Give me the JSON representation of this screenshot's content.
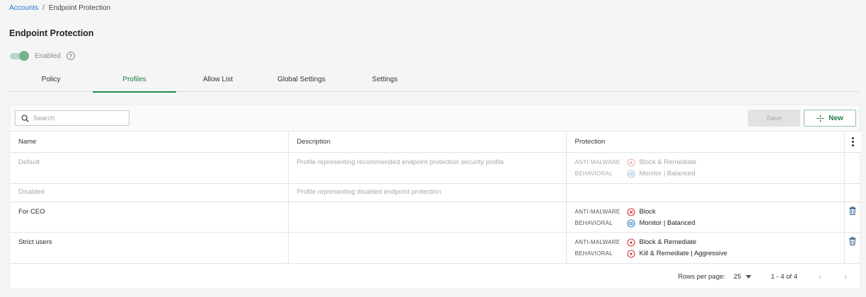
{
  "breadcrumb": {
    "root": "Accounts",
    "separator": "/",
    "current": "Endpoint Protection"
  },
  "page": {
    "title": "Endpoint Protection"
  },
  "status_toggle": {
    "label": "Enabled",
    "enabled": true,
    "help": "?"
  },
  "tabs": [
    {
      "label": "Policy",
      "active": false
    },
    {
      "label": "Profiles",
      "active": true
    },
    {
      "label": "Allow List",
      "active": false
    },
    {
      "label": "Global Settings",
      "active": false
    },
    {
      "label": "Settings",
      "active": false
    }
  ],
  "toolbar": {
    "search_placeholder": "Search",
    "save_label": "Save",
    "new_label": "New"
  },
  "table": {
    "columns": [
      "Name",
      "Description",
      "Protection"
    ],
    "rows": [
      {
        "name": "Default",
        "description": "Profile representing recommended endpoint protection security profile",
        "disabled": true,
        "protection": [
          {
            "label": "ANTI-MALWARE",
            "icon": "target-remediate-icon",
            "value": "Block & Remediate"
          },
          {
            "label": "BEHAVIORAL",
            "icon": "eye-monitor-icon",
            "value": "Monitor | Balanced"
          }
        ]
      },
      {
        "name": "Disabled",
        "description": "Profile representing disabled endpoint protection",
        "disabled": true,
        "protection": []
      },
      {
        "name": "For CEO",
        "description": "",
        "disabled": false,
        "protection": [
          {
            "label": "ANTI-MALWARE",
            "icon": "block-x-icon",
            "value": "Block"
          },
          {
            "label": "BEHAVIORAL",
            "icon": "eye-monitor-icon",
            "value": "Monitor | Balanced"
          }
        ]
      },
      {
        "name": "Strict users",
        "description": "",
        "disabled": false,
        "protection": [
          {
            "label": "ANTI-MALWARE",
            "icon": "target-remediate-icon",
            "value": "Block & Remediate"
          },
          {
            "label": "BEHAVIORAL",
            "icon": "target-remediate-icon",
            "value": "Kill & Remediate | Aggressive"
          }
        ]
      }
    ]
  },
  "pagination": {
    "rows_per_page_label": "Rows per page:",
    "rows_per_page": "25",
    "range": "1 - 4 of 4"
  },
  "colors": {
    "accent_green": "#1e7d47",
    "link_blue": "#1d76d2",
    "danger_red": "#d63a3a",
    "monitor_blue": "#2f7fc4"
  }
}
